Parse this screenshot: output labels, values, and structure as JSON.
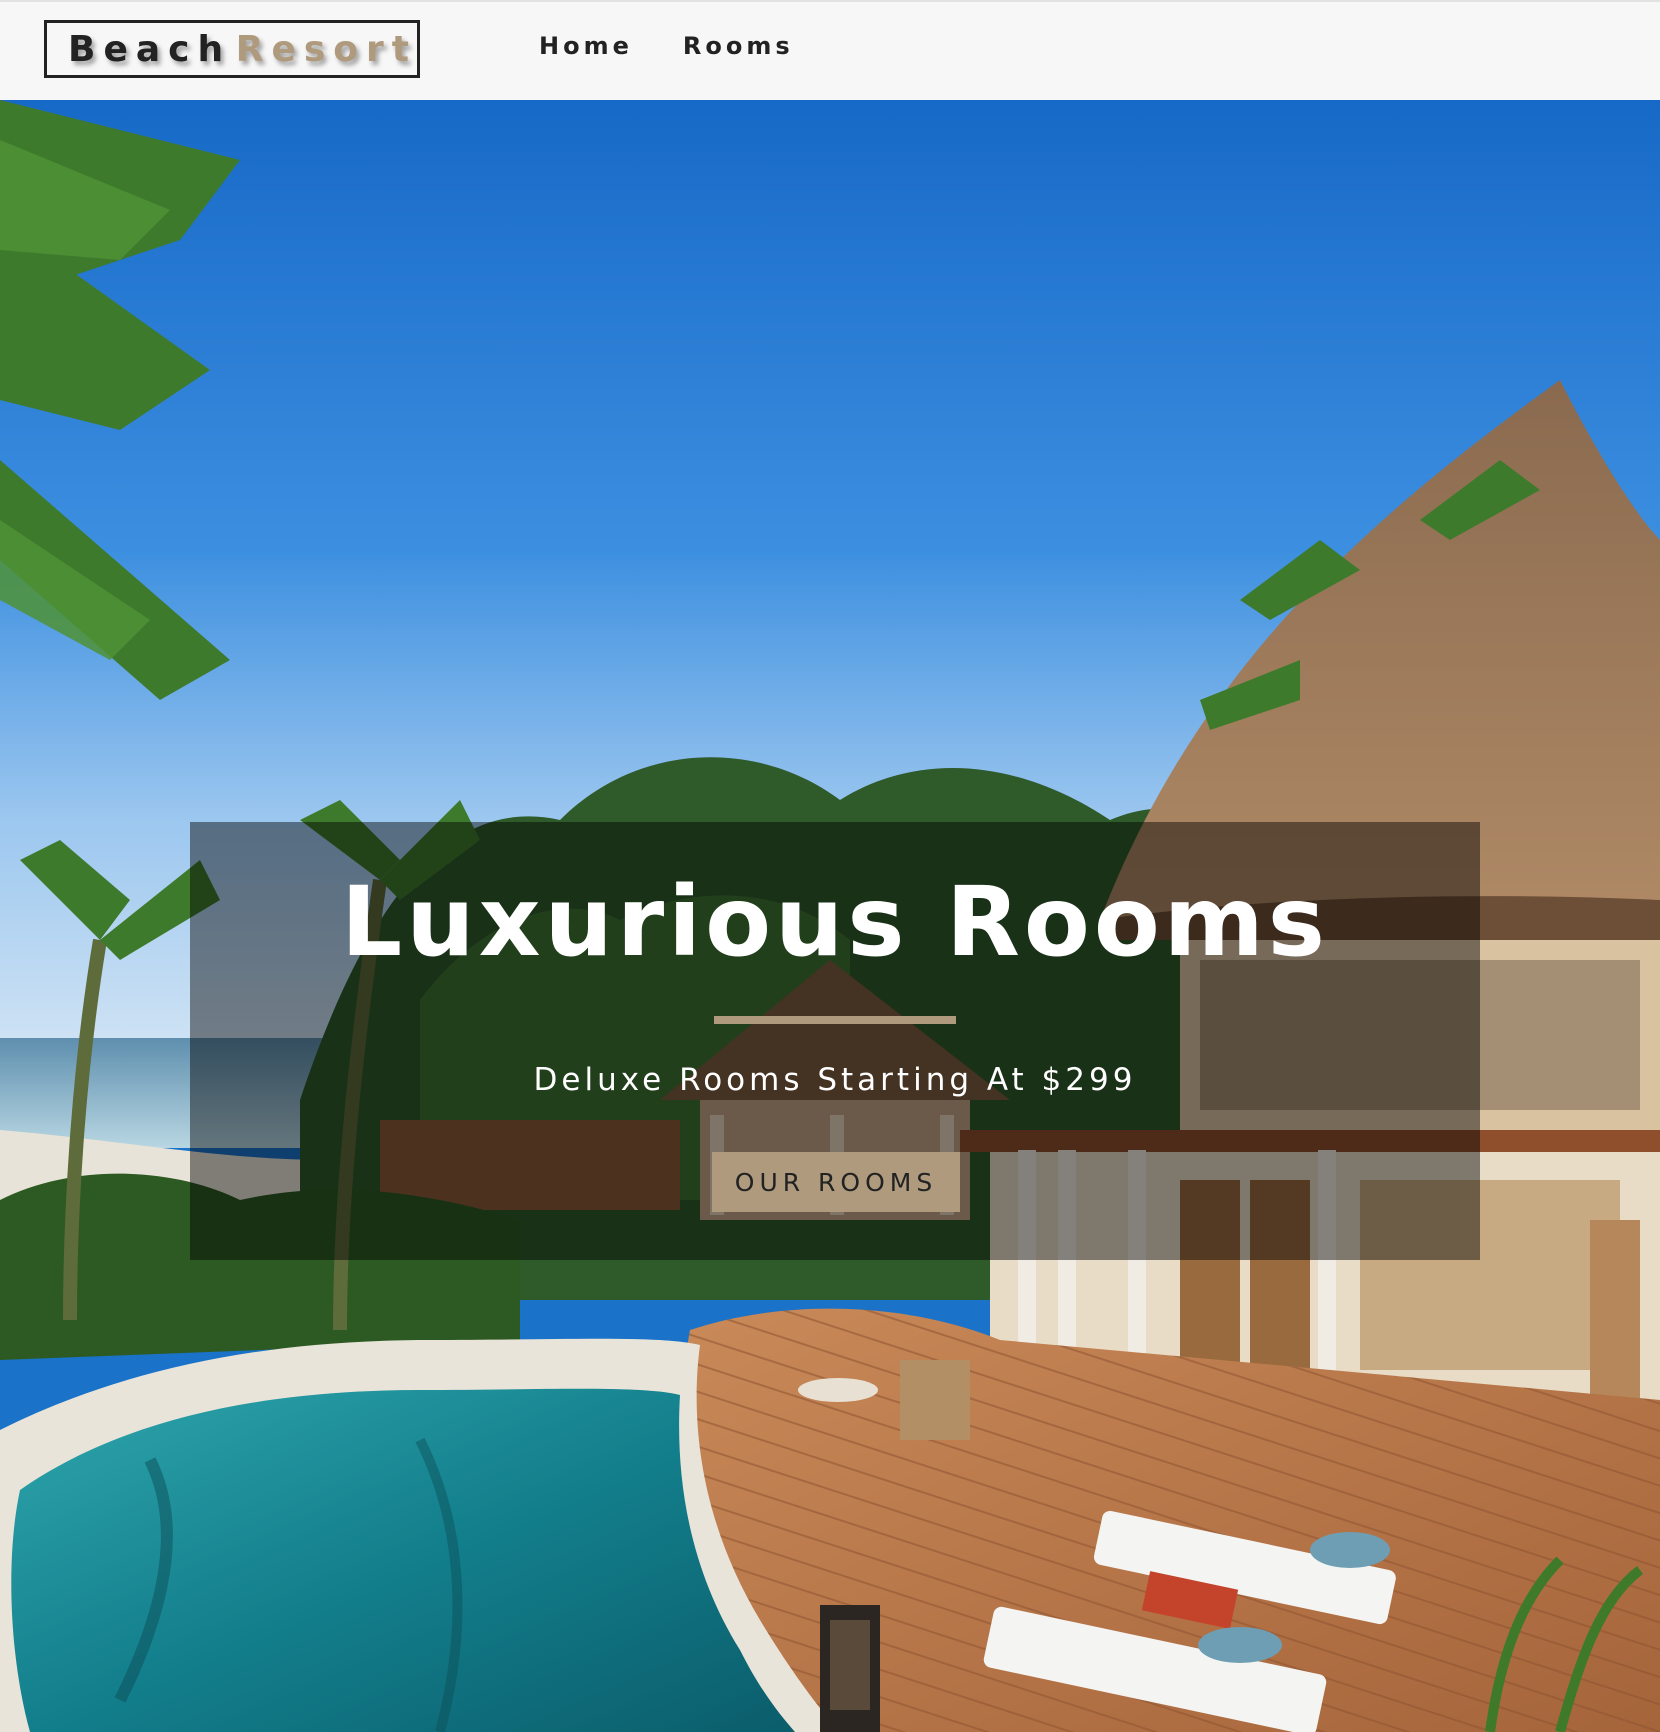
{
  "navbar": {
    "logo_word_1": "Beach",
    "logo_word_2": "Resort",
    "links": [
      {
        "label": "Home"
      },
      {
        "label": "Rooms"
      }
    ]
  },
  "hero": {
    "title": "Luxurious Rooms",
    "subtitle": "Deluxe Rooms Starting At $299",
    "button_label": "OUR ROOMS"
  },
  "colors": {
    "accent": "#af9a7d",
    "navbar_bg": "#f7f7f7",
    "text_dark": "#222222",
    "banner_overlay": "rgba(0,0,0,0.45)"
  }
}
